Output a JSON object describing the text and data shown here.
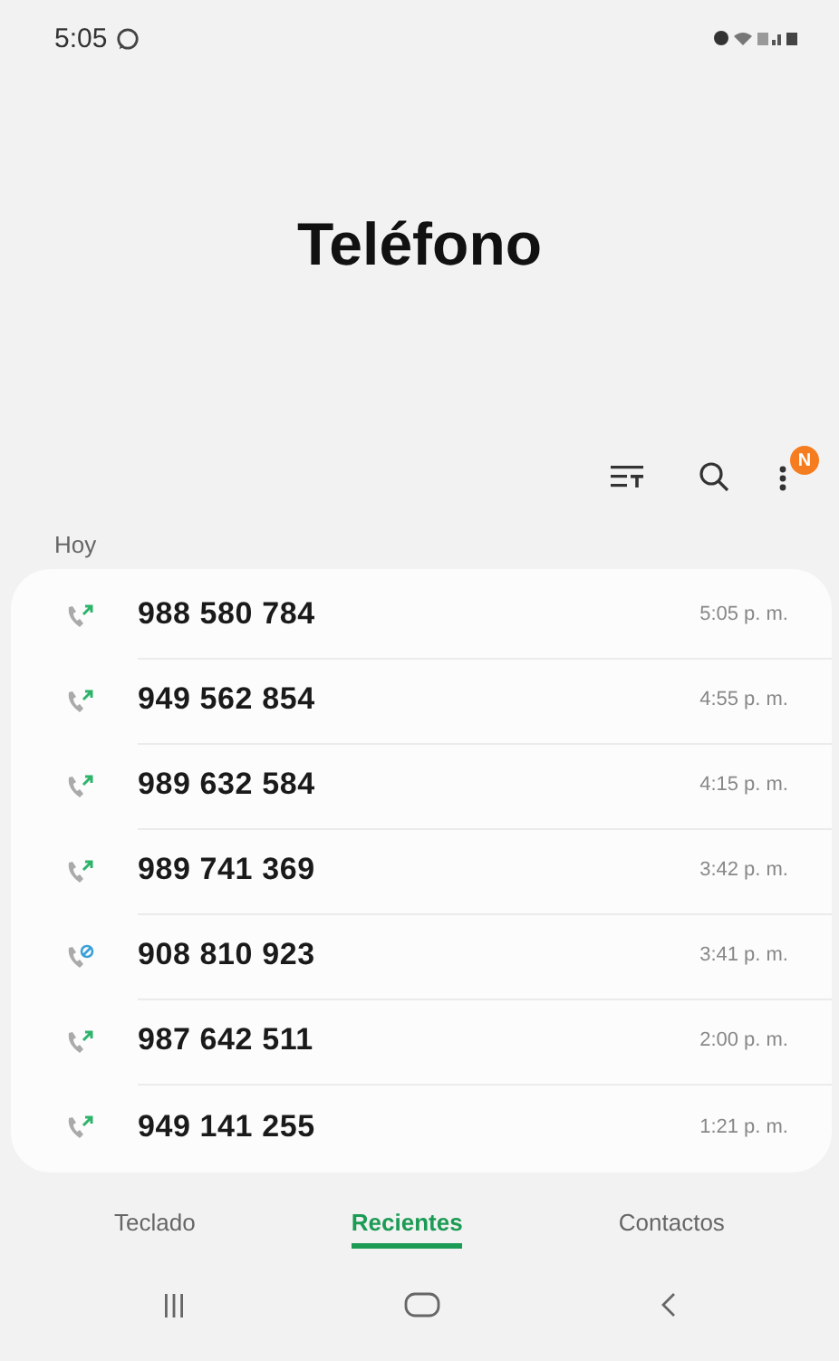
{
  "status_bar": {
    "time": "5:05"
  },
  "title": "Teléfono",
  "toolbar": {
    "badge": "N"
  },
  "section": "Hoy",
  "calls": [
    {
      "number": "988 580 784",
      "time": "5:05 p. m.",
      "kind": "outgoing"
    },
    {
      "number": "949 562 854",
      "time": "4:55 p. m.",
      "kind": "outgoing"
    },
    {
      "number": "989 632 584",
      "time": "4:15 p. m.",
      "kind": "outgoing"
    },
    {
      "number": "989 741 369",
      "time": "3:42 p. m.",
      "kind": "outgoing"
    },
    {
      "number": "908 810 923",
      "time": "3:41 p. m.",
      "kind": "blocked"
    },
    {
      "number": "987 642 511",
      "time": "2:00 p. m.",
      "kind": "outgoing"
    },
    {
      "number": "949 141 255",
      "time": "1:21 p. m.",
      "kind": "outgoing"
    }
  ],
  "tabs": [
    {
      "label": "Teclado",
      "selected": false
    },
    {
      "label": "Recientes",
      "selected": true
    },
    {
      "label": "Contactos",
      "selected": false
    }
  ]
}
